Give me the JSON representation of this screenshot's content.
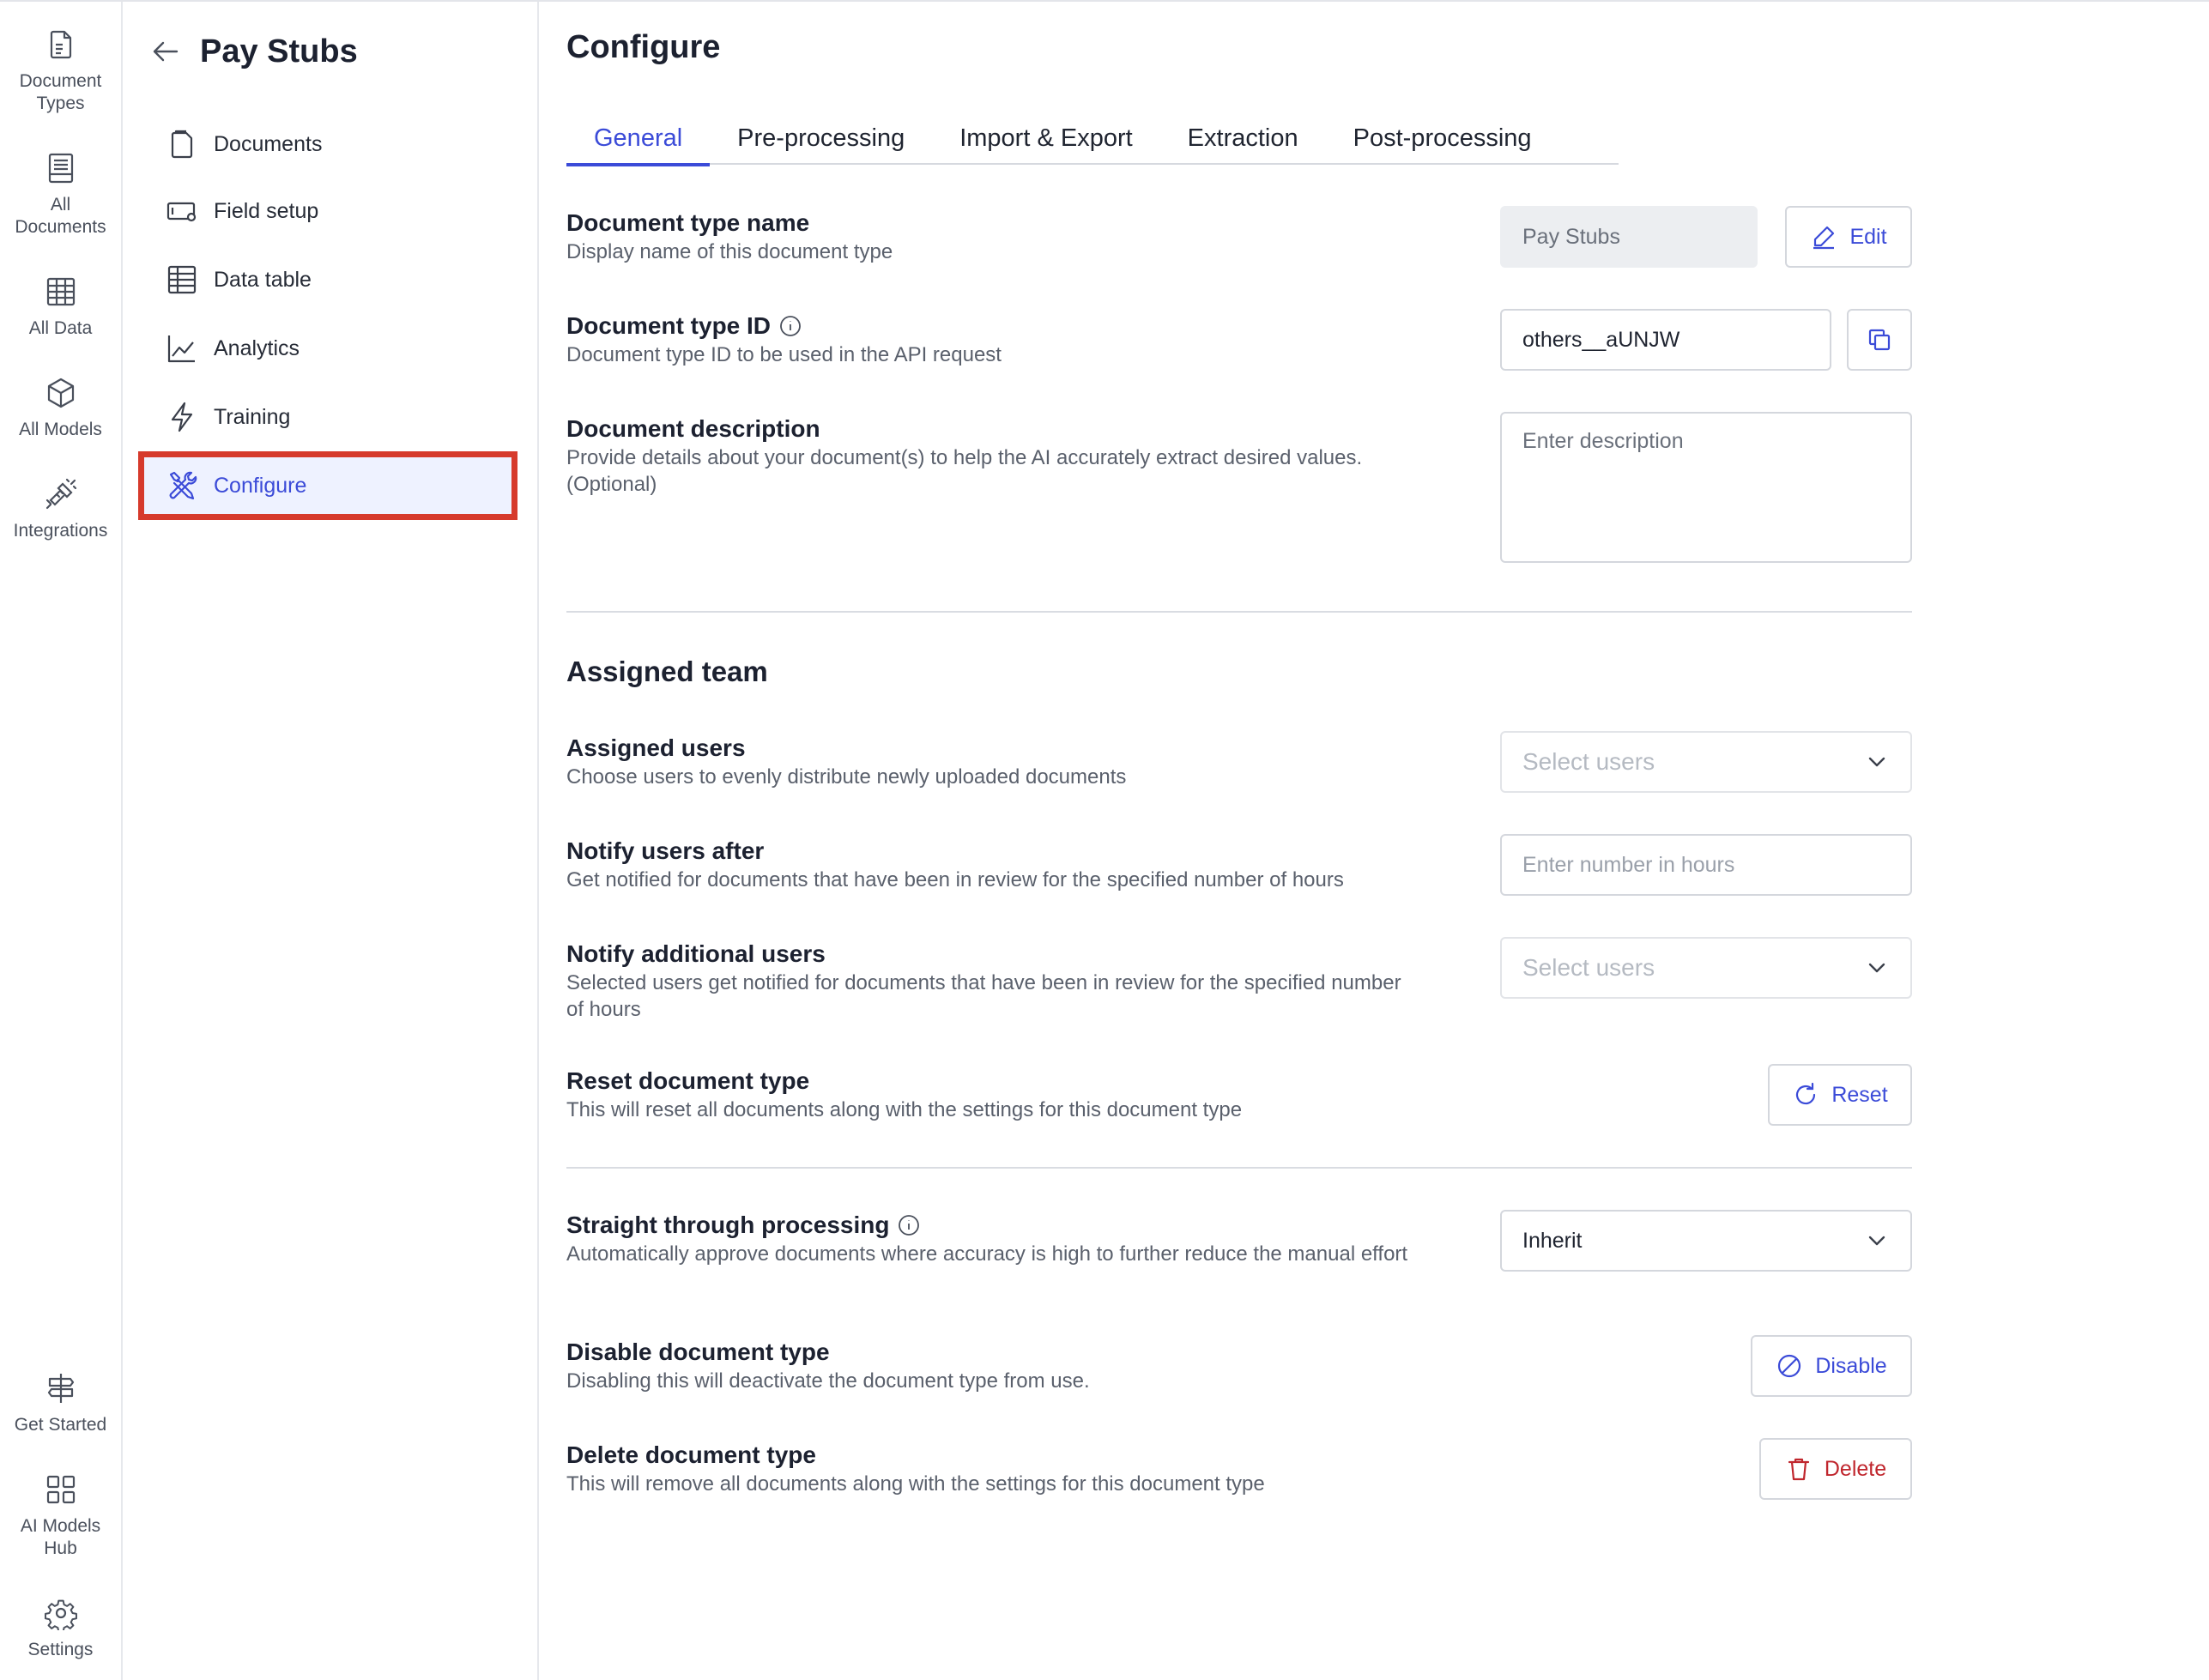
{
  "rail": {
    "top_items": [
      {
        "label": "Document Types",
        "icon": "document-types-icon"
      },
      {
        "label": "All Documents",
        "icon": "all-documents-icon"
      },
      {
        "label": "All Data",
        "icon": "all-data-icon"
      },
      {
        "label": "All Models",
        "icon": "all-models-icon"
      },
      {
        "label": "Integrations",
        "icon": "integrations-icon"
      }
    ],
    "bottom_items": [
      {
        "label": "Get Started",
        "icon": "signpost-icon"
      },
      {
        "label": "AI Models Hub",
        "icon": "grid-icon"
      },
      {
        "label": "Settings",
        "icon": "gear-icon"
      }
    ]
  },
  "subnav": {
    "title": "Pay Stubs",
    "items": [
      {
        "label": "Documents",
        "icon": "documents-icon"
      },
      {
        "label": "Field setup",
        "icon": "field-setup-icon"
      },
      {
        "label": "Data table",
        "icon": "data-table-icon"
      },
      {
        "label": "Analytics",
        "icon": "analytics-icon"
      },
      {
        "label": "Training",
        "icon": "lightning-icon"
      },
      {
        "label": "Configure",
        "icon": "tools-icon",
        "active": true
      }
    ]
  },
  "main": {
    "title": "Configure",
    "tabs": [
      {
        "label": "General",
        "active": true
      },
      {
        "label": "Pre-processing"
      },
      {
        "label": "Import & Export"
      },
      {
        "label": "Extraction"
      },
      {
        "label": "Post-processing"
      }
    ],
    "doc_type_name": {
      "title": "Document type name",
      "desc": "Display name of this document type",
      "value": "Pay Stubs",
      "button": "Edit"
    },
    "doc_type_id": {
      "title": "Document type ID",
      "desc": "Document type ID to be used in the API request",
      "value": "others__aUNJW"
    },
    "doc_description": {
      "title": "Document description",
      "desc": "Provide details about your document(s) to help the AI accurately extract desired values. (Optional)",
      "placeholder": "Enter description"
    },
    "assigned_team": {
      "heading": "Assigned team",
      "assigned_users": {
        "title": "Assigned users",
        "desc": "Choose users to evenly distribute newly uploaded documents",
        "placeholder": "Select users"
      },
      "notify_after": {
        "title": "Notify users after",
        "desc": "Get notified for documents that have been in review for the specified number of hours",
        "placeholder": "Enter number in hours"
      },
      "notify_additional": {
        "title": "Notify additional users",
        "desc": "Selected users get notified for documents that have been in review for the specified number of hours",
        "placeholder": "Select users"
      },
      "reset": {
        "title": "Reset document type",
        "desc": "This will reset all documents along with the settings for this document type",
        "button": "Reset"
      }
    },
    "stp": {
      "title": "Straight through processing",
      "desc": "Automatically approve documents where accuracy is high to further reduce the manual effort",
      "value": "Inherit"
    },
    "disable": {
      "title": "Disable document type",
      "desc": "Disabling this will deactivate the document type from use.",
      "button": "Disable"
    },
    "delete": {
      "title": "Delete document type",
      "desc": "This will remove all documents along with the settings for this document type",
      "button": "Delete"
    }
  },
  "colors": {
    "accent": "#3b4bd8",
    "danger": "#c0262d",
    "highlight_box": "#d63a2c",
    "active_bg": "#eef2ff"
  }
}
